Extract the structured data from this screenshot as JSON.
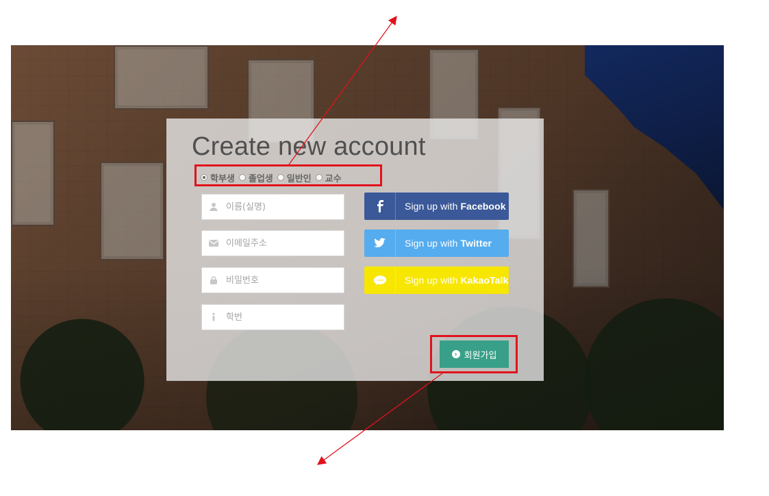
{
  "card": {
    "title": "Create new account",
    "user_types": [
      {
        "label": "학부생",
        "checked": true
      },
      {
        "label": "졸업생",
        "checked": false
      },
      {
        "label": "일반인",
        "checked": false
      },
      {
        "label": "교수",
        "checked": false
      }
    ],
    "inputs": {
      "name_placeholder": "이름(실명)",
      "email_placeholder": "이메일주소",
      "password_placeholder": "비밀번호",
      "student_id_placeholder": "학번"
    },
    "social": {
      "facebook": {
        "prefix": "Sign up with ",
        "brand": "Facebook",
        "color": "#3b5998"
      },
      "twitter": {
        "prefix": "Sign up with ",
        "brand": "Twitter",
        "color": "#55acee"
      },
      "kakaotalk": {
        "prefix": "Sign up with ",
        "brand": "KakaoTalk",
        "color": "#f7e600"
      }
    },
    "signup_button": {
      "label": "회원가입",
      "color": "#38a088"
    }
  },
  "annotations": {
    "highlight_color": "#e2121b",
    "arrow_color": "#e2121b"
  },
  "icons": {
    "user": "user-icon",
    "email": "envelope-icon",
    "password": "lock-icon",
    "student_id": "info-icon",
    "facebook": "facebook-icon",
    "twitter": "twitter-icon",
    "kakaotalk": "chat-bubble-icon",
    "signup": "arrow-circle-right-icon"
  }
}
